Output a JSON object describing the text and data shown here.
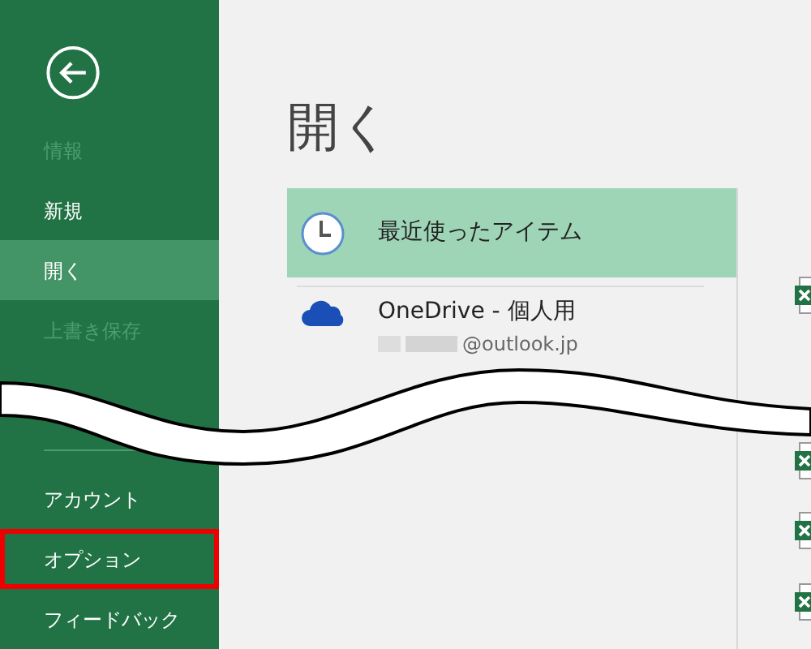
{
  "sidebar": {
    "items": [
      {
        "label": "情報",
        "disabled": true,
        "selected": false,
        "highlighted": false
      },
      {
        "label": "新規",
        "disabled": false,
        "selected": false,
        "highlighted": false
      },
      {
        "label": "開く",
        "disabled": false,
        "selected": true,
        "highlighted": false
      },
      {
        "label": "上書き保存",
        "disabled": true,
        "selected": false,
        "highlighted": false
      }
    ],
    "footer_items": [
      {
        "label": "アカウント",
        "disabled": false,
        "selected": false,
        "highlighted": false
      },
      {
        "label": "オプション",
        "disabled": false,
        "selected": false,
        "highlighted": true
      },
      {
        "label": "フィードバック",
        "disabled": false,
        "selected": false,
        "highlighted": false
      }
    ]
  },
  "page_title": "開く",
  "locations": [
    {
      "kind": "recent",
      "label": "最近使ったアイテム",
      "selected": true
    },
    {
      "kind": "onedrive",
      "label": "OneDrive - 個人用",
      "account": "@outlook.jp",
      "selected": false
    }
  ]
}
